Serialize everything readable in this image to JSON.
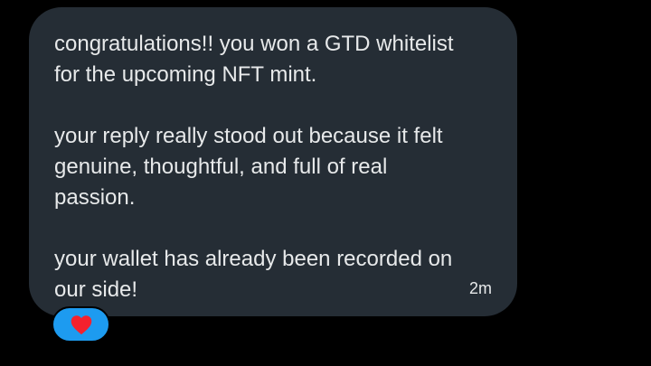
{
  "message": {
    "paragraphs": [
      "congratulations!! you won a GTD whitelist\nfor the upcoming NFT mint.",
      "your reply really stood out because it felt\ngenuine, thoughtful, and full of real\npassion.",
      "your wallet has already been recorded on\nour side!"
    ],
    "timestamp": "2m"
  },
  "reaction": {
    "icon": "heart-icon",
    "icon_color": "#f4212e",
    "background_color": "#1d9bf0"
  },
  "colors": {
    "page_background": "#000000",
    "bubble_background": "#252d35",
    "text": "#e7e9ea"
  }
}
